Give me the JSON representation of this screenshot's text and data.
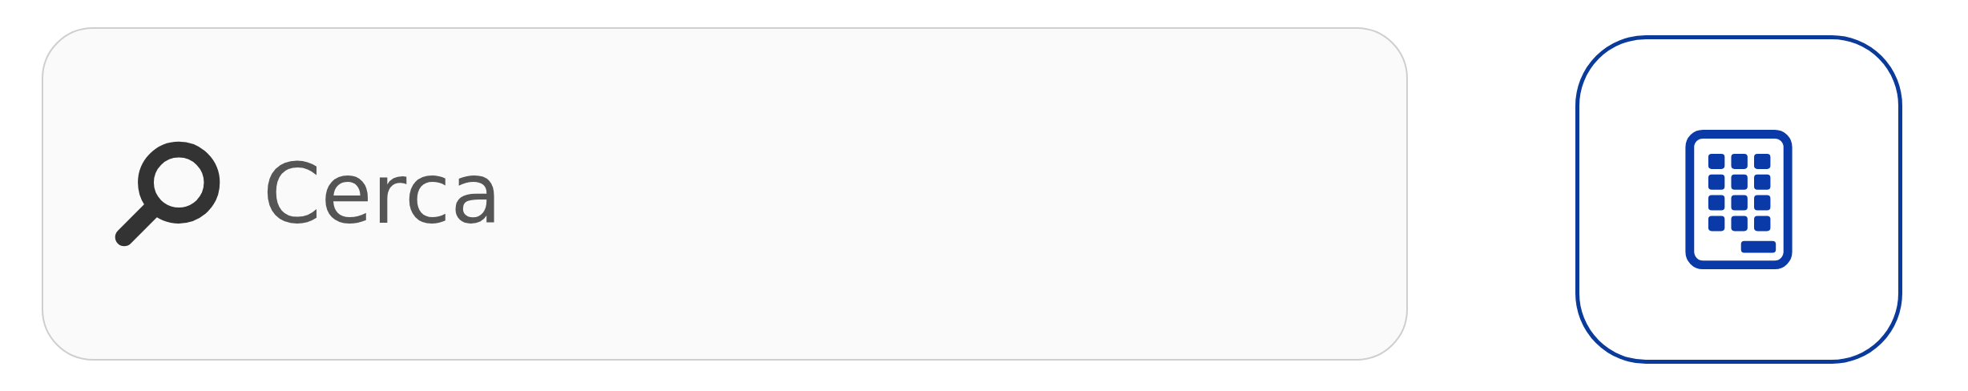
{
  "search": {
    "placeholder": "Cerca"
  }
}
